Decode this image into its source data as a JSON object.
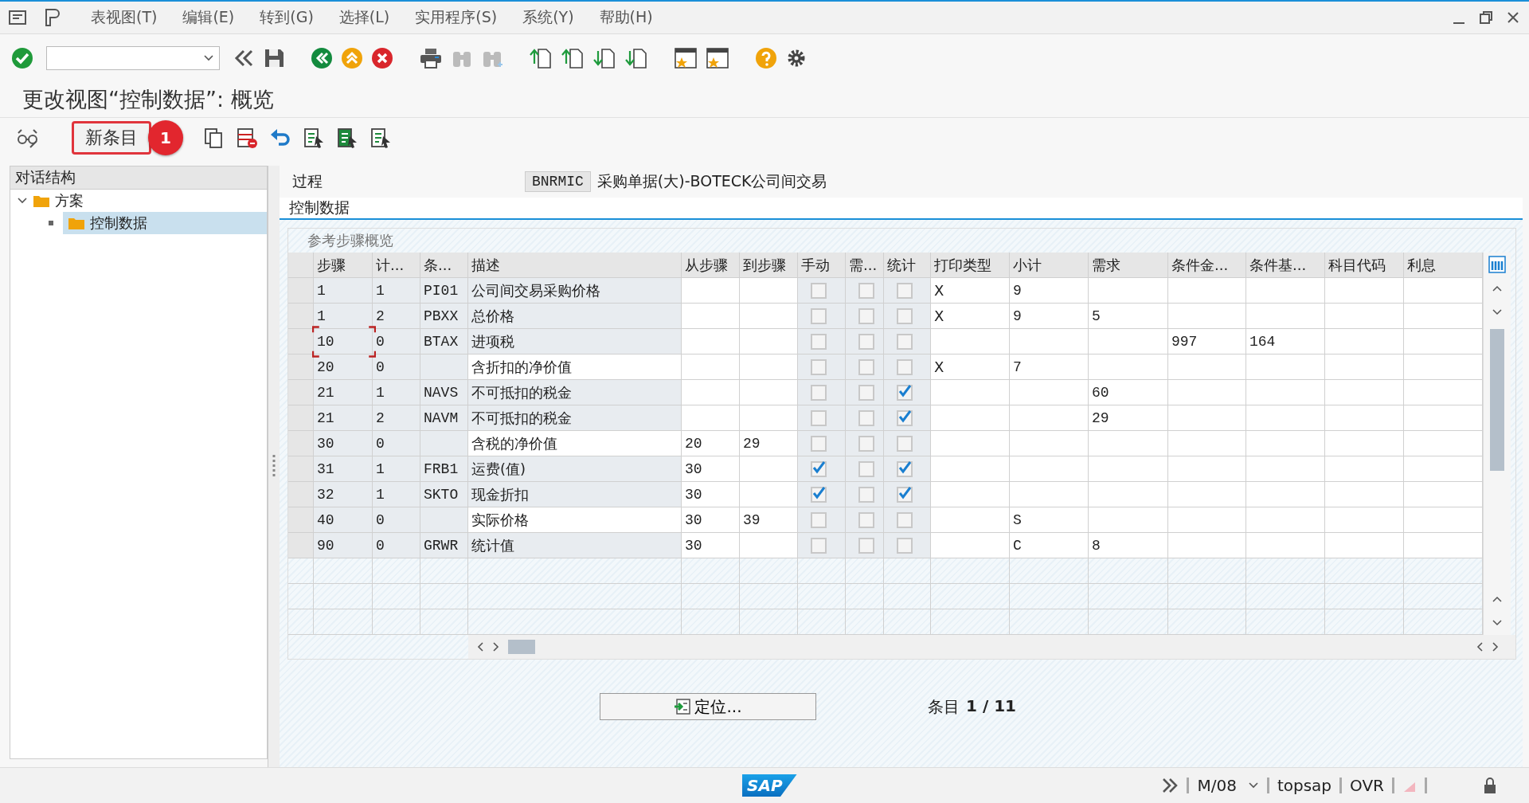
{
  "menu": {
    "items": [
      "表视图(T)",
      "编辑(E)",
      "转到(G)",
      "选择(L)",
      "实用程序(S)",
      "系统(Y)",
      "帮助(H)"
    ]
  },
  "title": "更改视图“控制数据”: 概览",
  "app_toolbar": {
    "new_entries_button": "新条目",
    "callout_badge": "1"
  },
  "dialog_structure": {
    "title": "对话结构",
    "tree": [
      {
        "label": "方案",
        "expanded": true,
        "selected": false,
        "children": [
          {
            "label": "控制数据",
            "selected": true
          }
        ]
      }
    ]
  },
  "procedure": {
    "label": "过程",
    "value": "BNRMIC",
    "description": "采购单据(大)-BOTECK公司间交易"
  },
  "tab": "控制数据",
  "table": {
    "title": "参考步骤概览",
    "columns": [
      {
        "label": "步骤",
        "kind": "text"
      },
      {
        "label": "计...",
        "kind": "text"
      },
      {
        "label": "条...",
        "kind": "text"
      },
      {
        "label": "描述",
        "kind": "text"
      },
      {
        "label": "从步骤",
        "kind": "text"
      },
      {
        "label": "到步骤",
        "kind": "text"
      },
      {
        "label": "手动",
        "kind": "check"
      },
      {
        "label": "需...",
        "kind": "check"
      },
      {
        "label": "统计",
        "kind": "check"
      },
      {
        "label": "打印类型",
        "kind": "text"
      },
      {
        "label": "小计",
        "kind": "text"
      },
      {
        "label": "需求",
        "kind": "text"
      },
      {
        "label": "条件金...",
        "kind": "text"
      },
      {
        "label": "条件基...",
        "kind": "text"
      },
      {
        "label": "科目代码",
        "kind": "text"
      },
      {
        "label": "利息",
        "kind": "text"
      }
    ],
    "rows": [
      {
        "step": "1",
        "counter": "1",
        "condition": "PI01",
        "description": "公司间交易采购价格",
        "manual": false,
        "required": false,
        "statistical": false,
        "print_type": "X",
        "subtotal": "9",
        "focused": false
      },
      {
        "step": "1",
        "counter": "2",
        "condition": "PBXX",
        "description": "总价格",
        "manual": false,
        "required": false,
        "statistical": false,
        "print_type": "X",
        "subtotal": "9",
        "requirement": "5",
        "focused": false
      },
      {
        "step": "10",
        "counter": "0",
        "condition": "BTAX",
        "description": "进项税",
        "manual": false,
        "required": false,
        "statistical": false,
        "cond_amount": "997",
        "cond_base": "164",
        "focused": true
      },
      {
        "step": "20",
        "counter": "0",
        "description": "含折扣的净价值",
        "manual": false,
        "required": false,
        "statistical": false,
        "print_type": "X",
        "subtotal": "7",
        "focused": false
      },
      {
        "step": "21",
        "counter": "1",
        "condition": "NAVS",
        "description": "不可抵扣的税金",
        "manual": false,
        "required": false,
        "statistical": true,
        "requirement": "60",
        "focused": false
      },
      {
        "step": "21",
        "counter": "2",
        "condition": "NAVM",
        "description": "不可抵扣的税金",
        "manual": false,
        "required": false,
        "statistical": true,
        "requirement": "29",
        "focused": false
      },
      {
        "step": "30",
        "counter": "0",
        "description": "含税的净价值",
        "from_step": "20",
        "to_step": "29",
        "manual": false,
        "required": false,
        "statistical": false,
        "focused": false
      },
      {
        "step": "31",
        "counter": "1",
        "condition": "FRB1",
        "description": "运费(值)",
        "from_step": "30",
        "manual": true,
        "required": false,
        "statistical": true,
        "focused": false
      },
      {
        "step": "32",
        "counter": "1",
        "condition": "SKTO",
        "description": "现金折扣",
        "from_step": "30",
        "manual": true,
        "required": false,
        "statistical": true,
        "focused": false
      },
      {
        "step": "40",
        "counter": "0",
        "description": "实际价格",
        "from_step": "30",
        "to_step": "39",
        "manual": false,
        "required": false,
        "statistical": false,
        "subtotal": "S",
        "focused": false
      },
      {
        "step": "90",
        "counter": "0",
        "condition": "GRWR",
        "description": "统计值",
        "from_step": "30",
        "manual": false,
        "required": false,
        "statistical": false,
        "subtotal": "C",
        "requirement": "8",
        "focused": false
      }
    ]
  },
  "position_button": "定位...",
  "entry_counter": {
    "label": "条目",
    "value": "1 / 11"
  },
  "status_bar": {
    "logo": "SAP",
    "items": [
      "M/08",
      "topsap",
      "OVR"
    ]
  }
}
